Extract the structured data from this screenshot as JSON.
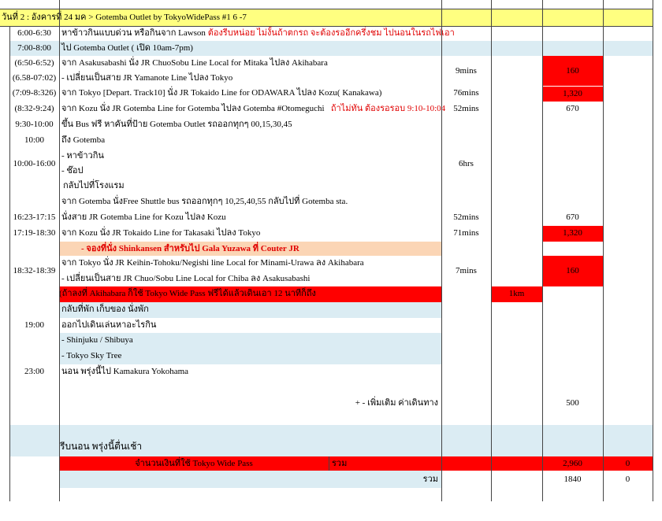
{
  "header": "วันที่ 2 : อังคารที่ 24 มค > Gotemba Outlet by TokyoWidePass #1  6 -7",
  "rows": [
    {
      "time": "6:00-6:30",
      "text": "หาข้าวกินแบบด่วน หรือกินจาก Lawson",
      "note": "ต้องรีบหน่อย ไม่งั้นถ้าตกรถ จะต้องรออีกครึ่งชม ไปนอนในรถไฟเอา"
    },
    {
      "time": "7:00-8:00",
      "text": "ไป Gotemba Outlet ( เปิด 10am-7pm)"
    },
    {
      "time": "(6:50-6:52)",
      "text": "จาก Asakusabashi นั่ง JR ChuoSobu Line Local for Mitaka ไปลง Akihabara"
    },
    {
      "time": "(6.58-07:02)",
      "text": "- เปลี่ยนเป็นสาย JR Yamanote Line ไปลง Tokyo"
    },
    {
      "time": "(7:09-8:326)",
      "text": "จาก Tokyo [Depart. Track10] นั่ง JR Tokaido Line for ODAWARA ไปลง Kozu( Kanakawa)"
    },
    {
      "time": "(8:32-9:24)",
      "text": "จาก Kozu นั่ง JR Gotemba Line for Gotemba ไปลง Gotemba #Otomeguchi",
      "note": "ถ้าไม่ทัน ต้องรอรอบ 9:10-10:04"
    },
    {
      "time": "9:30-10:00",
      "text": "ขึ้น Bus ฟรี หาคันที่ป้าย Gotemba Outlet รถออกทุกๆ 00,15,30,45"
    },
    {
      "time": "10:00",
      "text": "ถึง Gotemba"
    },
    {
      "time": "10:00-16:00",
      "text": "- หาข้าวกิน"
    },
    {
      "text": "- ช๊อป"
    },
    {
      "text": "กลับไปที่โรงแรม"
    },
    {
      "text": "จาก Gotemba นั่งFree Shuttle bus  รถออกทุกๆ 10,25,40,55 กลับไปที่ Gotemba sta."
    },
    {
      "time": "16:23-17:15",
      "text": "นั่งสาย JR Gotemba Line for  Kozu ไปลง Kozu"
    },
    {
      "time": "17:19-18:30",
      "text": "จาก Kozu นั่ง JR Tokaido Line for Takasaki ไปลง Tokyo"
    },
    {
      "text": "- จองที่นั่ง Shinkansen สำหรับไป Gala Yuzawa ที่ Couter JR"
    },
    {
      "time": "18:32-18:39",
      "text": "จาก Tokyo นั่ง JR Keihin-Tohoku/Negishi line Local for Minami-Urawa ลง Akihabara"
    },
    {
      "text": "- เปลี่ยนเป็นสาย JR Chuo/Sobu Line Local for Chiba ลง Asakusabashi"
    },
    {
      "text": "(ถ้าลงที่ Akihabara ก็ใช้ Tokyo Wide Pass ฟรีได้แล้วเดินเอา 12 นาทีก็ถึง"
    },
    {
      "text": "กลับที่พัก เก็บของ นั่งพัก"
    },
    {
      "time": "19:00",
      "text": "ออกไปเดินเล่นหาอะไรกิน"
    },
    {
      "text": "- Shinjuku / Shibuya"
    },
    {
      "text": "- Tokyo Sky Tree"
    },
    {
      "time": "23:00",
      "text": "นอน พรุ่งนี้ไป Kamakura Yokohama"
    }
  ],
  "durations": {
    "a": "9mins",
    "b": "76mins",
    "c": "52mins",
    "d": "6hrs",
    "e": "52mins",
    "f": "71mins",
    "g": "7mins"
  },
  "distance": "1km",
  "costs": {
    "a": "160",
    "b": "1,320",
    "c": "670",
    "d": "670",
    "e": "1,320",
    "f": "160"
  },
  "extra": {
    "label": "+ - เพิ่มเติม ค่าเดินทาง",
    "value": "500"
  },
  "sleep": "รีบนอน พรุ่งนี้ตื่นเช้า",
  "pass_total": {
    "label": "จำนวนเงินที่ใช้ Tokyo Wide Pass",
    "sum_label": "รวม",
    "value": "2,960",
    "other": "0"
  },
  "total": {
    "label": "รวม",
    "value": "1840",
    "other": "0"
  }
}
